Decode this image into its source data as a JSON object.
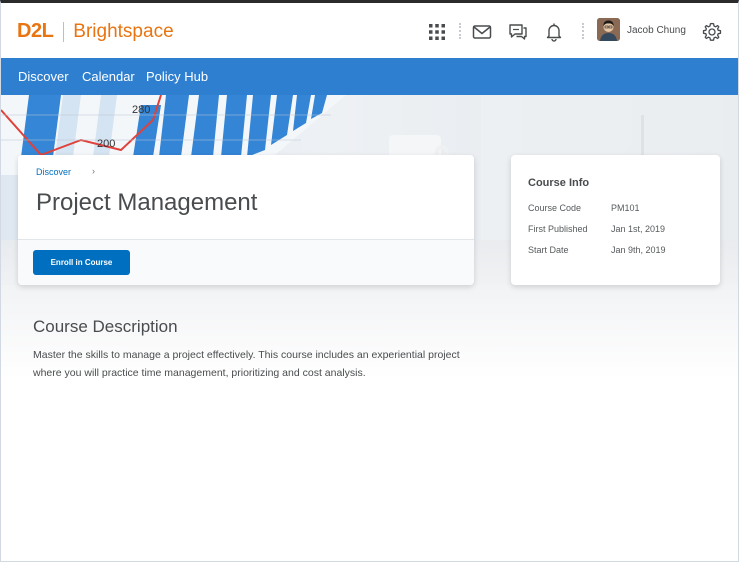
{
  "brand": {
    "logo": "D2L",
    "product": "Brightspace",
    "color": "#e87511"
  },
  "header": {
    "icons": [
      "waffle-grid-icon",
      "mail-icon",
      "chat-icon",
      "bell-icon",
      "gear-icon"
    ],
    "user_name": "Jacob Chung"
  },
  "nav": {
    "items": [
      "Discover",
      "Calendar",
      "Policy Hub"
    ],
    "color": "#2e7fcf"
  },
  "hero": {
    "chart_labels": [
      "280",
      "200"
    ]
  },
  "course": {
    "breadcrumb": "Discover",
    "breadcrumb_chevron": "›",
    "title": "Project Management",
    "enroll_label": "Enroll in Course"
  },
  "course_info": {
    "title": "Course Info",
    "rows": [
      {
        "label": "Course Code",
        "value": "PM101"
      },
      {
        "label": "First Published",
        "value": "Jan 1st, 2019"
      },
      {
        "label": "Start Date",
        "value": "Jan 9th, 2019"
      }
    ]
  },
  "description": {
    "heading": "Course Description",
    "text": "Master the skills to manage a project effectively. This course includes an experiential project where you will practice time management, prioritizing and cost analysis."
  }
}
